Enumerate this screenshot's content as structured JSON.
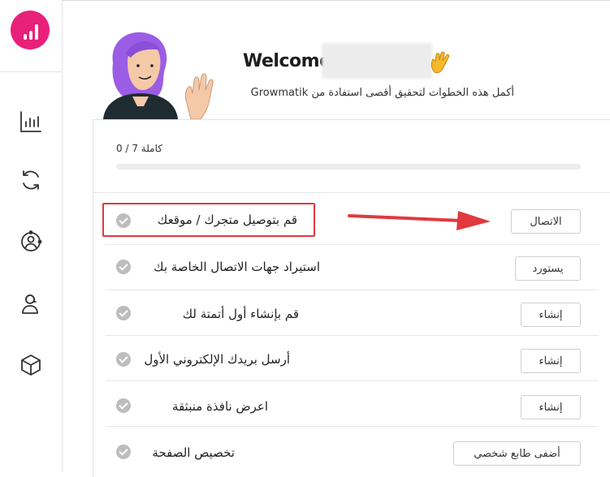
{
  "sidebar": {
    "logo": "growmatik-logo",
    "items": [
      {
        "icon": "bar-chart-icon"
      },
      {
        "icon": "sync-icon"
      },
      {
        "icon": "user-network-icon"
      },
      {
        "icon": "support-agent-icon"
      },
      {
        "icon": "cube-icon"
      }
    ]
  },
  "header": {
    "welcome": "Welcome",
    "subtitle": "أكمل هذه الخطوات لتحقيق أقصى استفادة من Growmatik"
  },
  "progress": {
    "label": "كاملة 7 / 0",
    "completed": 0,
    "total": 7
  },
  "steps": [
    {
      "label": "قم بتوصيل متجرك / موقعك",
      "button": "الاتصال"
    },
    {
      "label": "استيراد جهات الاتصال الخاصة بك",
      "button": "يستورد"
    },
    {
      "label": "قم بإنشاء أول أتمتة لك",
      "button": "إنشاء"
    },
    {
      "label": "أرسل بريدك الإلكتروني الأول",
      "button": "إنشاء"
    },
    {
      "label": "اعرض نافذة منبثقة",
      "button": "إنشاء"
    },
    {
      "label": "تخصيص الصفحة",
      "button": "أضفى طابع شخصي"
    }
  ],
  "colors": {
    "brand": "#e9207a",
    "annotation": "#e0393e"
  }
}
